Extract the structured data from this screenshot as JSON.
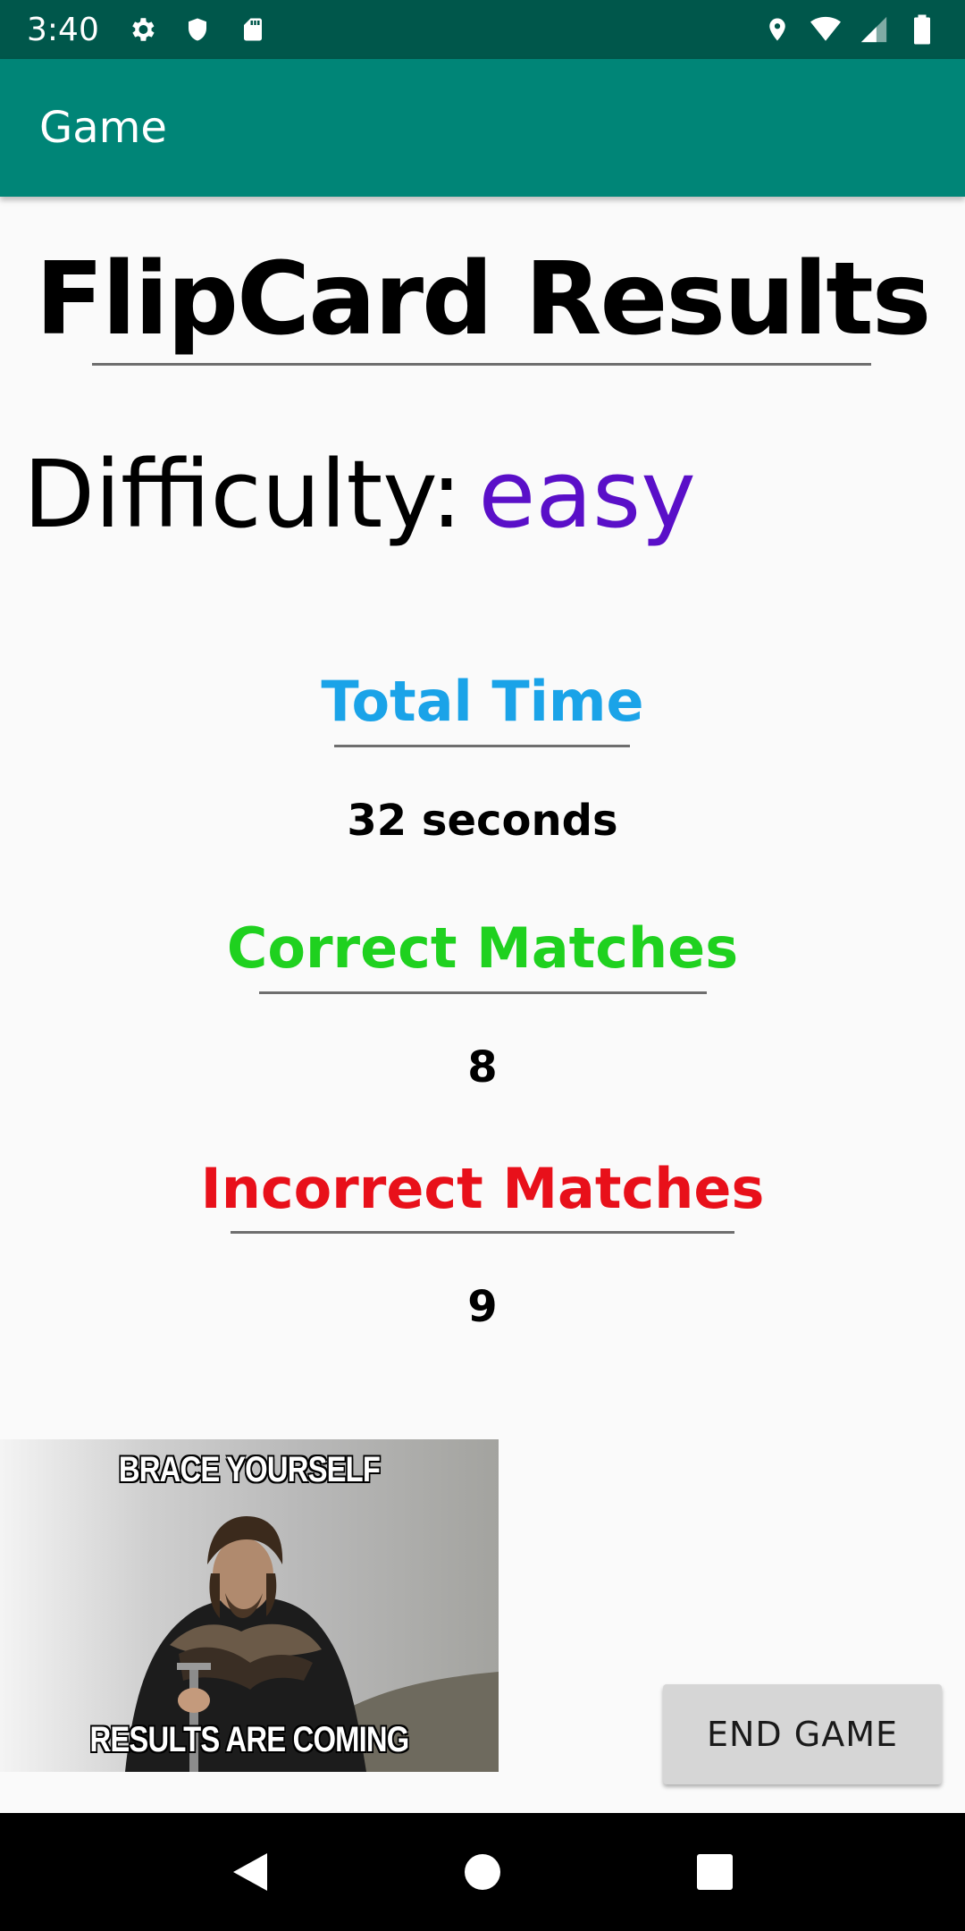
{
  "status_bar": {
    "time": "3:40",
    "left_icons": [
      "gear-icon",
      "shield-icon",
      "sd-card-icon"
    ],
    "right_icons": [
      "location-icon",
      "wifi-icon",
      "signal-icon",
      "battery-icon"
    ]
  },
  "app_bar": {
    "title": "Game"
  },
  "results": {
    "title": "FlipCard Results",
    "difficulty_label": "Difficulty:",
    "difficulty_value": "easy",
    "total_time_label": "Total Time",
    "total_time_value": "32 seconds",
    "correct_label": "Correct Matches",
    "correct_value": "8",
    "incorrect_label": "Incorrect Matches",
    "incorrect_value": "9"
  },
  "meme": {
    "top_text": "BRACE YOURSELF",
    "bottom_text": "RESULTS ARE COMING"
  },
  "buttons": {
    "end_game": "END GAME"
  },
  "colors": {
    "status_bar": "#00574b",
    "app_bar": "#008577",
    "difficulty_value": "#5a0fc8",
    "total_time": "#1aa3e8",
    "correct": "#1fd11f",
    "incorrect": "#e8101a"
  },
  "nav_bar": {
    "icons": [
      "back-icon",
      "home-icon",
      "recents-icon"
    ]
  }
}
